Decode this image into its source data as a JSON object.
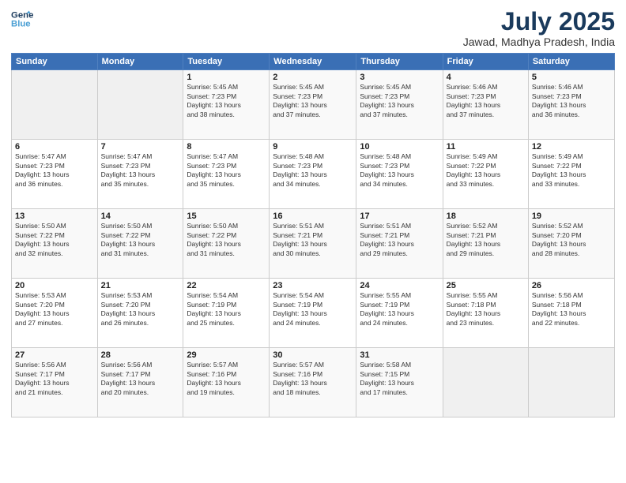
{
  "header": {
    "logo_line1": "General",
    "logo_line2": "Blue",
    "month": "July 2025",
    "location": "Jawad, Madhya Pradesh, India"
  },
  "days_of_week": [
    "Sunday",
    "Monday",
    "Tuesday",
    "Wednesday",
    "Thursday",
    "Friday",
    "Saturday"
  ],
  "weeks": [
    [
      {
        "num": "",
        "sunrise": "",
        "sunset": "",
        "daylight": ""
      },
      {
        "num": "",
        "sunrise": "",
        "sunset": "",
        "daylight": ""
      },
      {
        "num": "1",
        "sunrise": "Sunrise: 5:45 AM",
        "sunset": "Sunset: 7:23 PM",
        "daylight": "Daylight: 13 hours and 38 minutes."
      },
      {
        "num": "2",
        "sunrise": "Sunrise: 5:45 AM",
        "sunset": "Sunset: 7:23 PM",
        "daylight": "Daylight: 13 hours and 37 minutes."
      },
      {
        "num": "3",
        "sunrise": "Sunrise: 5:45 AM",
        "sunset": "Sunset: 7:23 PM",
        "daylight": "Daylight: 13 hours and 37 minutes."
      },
      {
        "num": "4",
        "sunrise": "Sunrise: 5:46 AM",
        "sunset": "Sunset: 7:23 PM",
        "daylight": "Daylight: 13 hours and 37 minutes."
      },
      {
        "num": "5",
        "sunrise": "Sunrise: 5:46 AM",
        "sunset": "Sunset: 7:23 PM",
        "daylight": "Daylight: 13 hours and 36 minutes."
      }
    ],
    [
      {
        "num": "6",
        "sunrise": "Sunrise: 5:47 AM",
        "sunset": "Sunset: 7:23 PM",
        "daylight": "Daylight: 13 hours and 36 minutes."
      },
      {
        "num": "7",
        "sunrise": "Sunrise: 5:47 AM",
        "sunset": "Sunset: 7:23 PM",
        "daylight": "Daylight: 13 hours and 35 minutes."
      },
      {
        "num": "8",
        "sunrise": "Sunrise: 5:47 AM",
        "sunset": "Sunset: 7:23 PM",
        "daylight": "Daylight: 13 hours and 35 minutes."
      },
      {
        "num": "9",
        "sunrise": "Sunrise: 5:48 AM",
        "sunset": "Sunset: 7:23 PM",
        "daylight": "Daylight: 13 hours and 34 minutes."
      },
      {
        "num": "10",
        "sunrise": "Sunrise: 5:48 AM",
        "sunset": "Sunset: 7:23 PM",
        "daylight": "Daylight: 13 hours and 34 minutes."
      },
      {
        "num": "11",
        "sunrise": "Sunrise: 5:49 AM",
        "sunset": "Sunset: 7:22 PM",
        "daylight": "Daylight: 13 hours and 33 minutes."
      },
      {
        "num": "12",
        "sunrise": "Sunrise: 5:49 AM",
        "sunset": "Sunset: 7:22 PM",
        "daylight": "Daylight: 13 hours and 33 minutes."
      }
    ],
    [
      {
        "num": "13",
        "sunrise": "Sunrise: 5:50 AM",
        "sunset": "Sunset: 7:22 PM",
        "daylight": "Daylight: 13 hours and 32 minutes."
      },
      {
        "num": "14",
        "sunrise": "Sunrise: 5:50 AM",
        "sunset": "Sunset: 7:22 PM",
        "daylight": "Daylight: 13 hours and 31 minutes."
      },
      {
        "num": "15",
        "sunrise": "Sunrise: 5:50 AM",
        "sunset": "Sunset: 7:22 PM",
        "daylight": "Daylight: 13 hours and 31 minutes."
      },
      {
        "num": "16",
        "sunrise": "Sunrise: 5:51 AM",
        "sunset": "Sunset: 7:21 PM",
        "daylight": "Daylight: 13 hours and 30 minutes."
      },
      {
        "num": "17",
        "sunrise": "Sunrise: 5:51 AM",
        "sunset": "Sunset: 7:21 PM",
        "daylight": "Daylight: 13 hours and 29 minutes."
      },
      {
        "num": "18",
        "sunrise": "Sunrise: 5:52 AM",
        "sunset": "Sunset: 7:21 PM",
        "daylight": "Daylight: 13 hours and 29 minutes."
      },
      {
        "num": "19",
        "sunrise": "Sunrise: 5:52 AM",
        "sunset": "Sunset: 7:20 PM",
        "daylight": "Daylight: 13 hours and 28 minutes."
      }
    ],
    [
      {
        "num": "20",
        "sunrise": "Sunrise: 5:53 AM",
        "sunset": "Sunset: 7:20 PM",
        "daylight": "Daylight: 13 hours and 27 minutes."
      },
      {
        "num": "21",
        "sunrise": "Sunrise: 5:53 AM",
        "sunset": "Sunset: 7:20 PM",
        "daylight": "Daylight: 13 hours and 26 minutes."
      },
      {
        "num": "22",
        "sunrise": "Sunrise: 5:54 AM",
        "sunset": "Sunset: 7:19 PM",
        "daylight": "Daylight: 13 hours and 25 minutes."
      },
      {
        "num": "23",
        "sunrise": "Sunrise: 5:54 AM",
        "sunset": "Sunset: 7:19 PM",
        "daylight": "Daylight: 13 hours and 24 minutes."
      },
      {
        "num": "24",
        "sunrise": "Sunrise: 5:55 AM",
        "sunset": "Sunset: 7:19 PM",
        "daylight": "Daylight: 13 hours and 24 minutes."
      },
      {
        "num": "25",
        "sunrise": "Sunrise: 5:55 AM",
        "sunset": "Sunset: 7:18 PM",
        "daylight": "Daylight: 13 hours and 23 minutes."
      },
      {
        "num": "26",
        "sunrise": "Sunrise: 5:56 AM",
        "sunset": "Sunset: 7:18 PM",
        "daylight": "Daylight: 13 hours and 22 minutes."
      }
    ],
    [
      {
        "num": "27",
        "sunrise": "Sunrise: 5:56 AM",
        "sunset": "Sunset: 7:17 PM",
        "daylight": "Daylight: 13 hours and 21 minutes."
      },
      {
        "num": "28",
        "sunrise": "Sunrise: 5:56 AM",
        "sunset": "Sunset: 7:17 PM",
        "daylight": "Daylight: 13 hours and 20 minutes."
      },
      {
        "num": "29",
        "sunrise": "Sunrise: 5:57 AM",
        "sunset": "Sunset: 7:16 PM",
        "daylight": "Daylight: 13 hours and 19 minutes."
      },
      {
        "num": "30",
        "sunrise": "Sunrise: 5:57 AM",
        "sunset": "Sunset: 7:16 PM",
        "daylight": "Daylight: 13 hours and 18 minutes."
      },
      {
        "num": "31",
        "sunrise": "Sunrise: 5:58 AM",
        "sunset": "Sunset: 7:15 PM",
        "daylight": "Daylight: 13 hours and 17 minutes."
      },
      {
        "num": "",
        "sunrise": "",
        "sunset": "",
        "daylight": ""
      },
      {
        "num": "",
        "sunrise": "",
        "sunset": "",
        "daylight": ""
      }
    ]
  ]
}
